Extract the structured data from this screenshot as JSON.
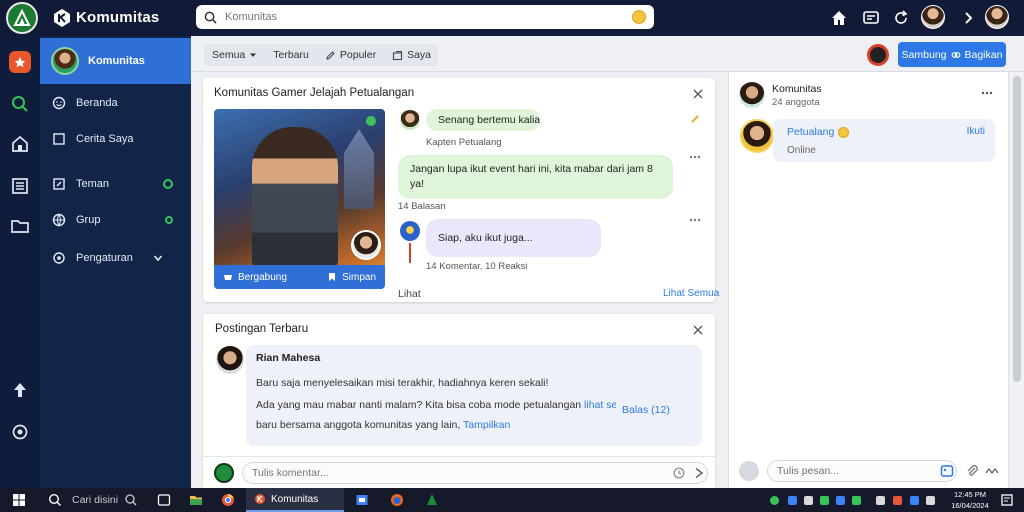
{
  "app": {
    "title": "Komumitas"
  },
  "search": {
    "placeholder": "Komunitas"
  },
  "sidebar": {
    "active_label": "Komunitas",
    "items": [
      {
        "label": "Beranda",
        "icon": "smiley-icon"
      },
      {
        "label": "Cerita Saya",
        "icon": "square-icon"
      },
      {
        "label": "Teman",
        "icon": "edit-icon"
      },
      {
        "label": "Grup",
        "icon": "globe-icon"
      },
      {
        "label": "Pengaturan",
        "icon": "settings-icon"
      }
    ]
  },
  "toolbar": {
    "buttons": [
      {
        "label": "Semua",
        "icon": ""
      },
      {
        "label": "Terbaru",
        "icon": ""
      },
      {
        "label": "Populer",
        "icon": "pencil-icon"
      },
      {
        "label": "Saya",
        "icon": "share-icon"
      }
    ],
    "cta_left": "Sambung",
    "cta_right": "Bagikan"
  },
  "card1": {
    "title": "Komunitas Gamer Jelajah Petualangan",
    "game_left": "Bergabung",
    "game_right": "Simpan",
    "messages": [
      {
        "text": "Senang bertemu kalian!",
        "meta": "Kapten Petualang"
      },
      {
        "text": "Jangan lupa ikut event hari ini, kita mabar dari jam 8 ya!",
        "meta": "14 Balasan"
      },
      {
        "text": "Siap, aku ikut juga...",
        "meta": "14 Komentar, 10 Reaksi"
      }
    ],
    "footer": "Lihat",
    "footer_link": "Lihat Semua"
  },
  "card2": {
    "title": "Postingan Terbaru",
    "post_name": "Rian Mahesa",
    "post_lines": [
      "Baru saja menyelesaikan misi terakhir, hadiahnya keren sekali!",
      "Ada yang mau mabar nanti malam? Kita bisa coba mode petualangan",
      "baru bersama anggota komunitas yang lain,"
    ],
    "link_text": "lihat selengkapnya",
    "link_text_2": "Tampilkan",
    "post_side": "Balas (12)",
    "compose_placeholder": "Tulis komentar..."
  },
  "right": {
    "title": "Komunitas",
    "subtitle": "24 anggota",
    "card_name": "Petualang",
    "card_sub": "Online",
    "card_action": "Ikuti",
    "compose_placeholder": "Tulis pesan..."
  },
  "taskbar": {
    "search_label": "Cari disini",
    "app_label": "Komunitas",
    "time": "12:45 PM",
    "date": "16/04/2024"
  },
  "colors": {
    "accent": "#2e78e6",
    "sidebar": "#132449",
    "topbar": "#111a36",
    "bubble_green": "#dff5d9",
    "bubble_purple": "#ece6fb"
  }
}
